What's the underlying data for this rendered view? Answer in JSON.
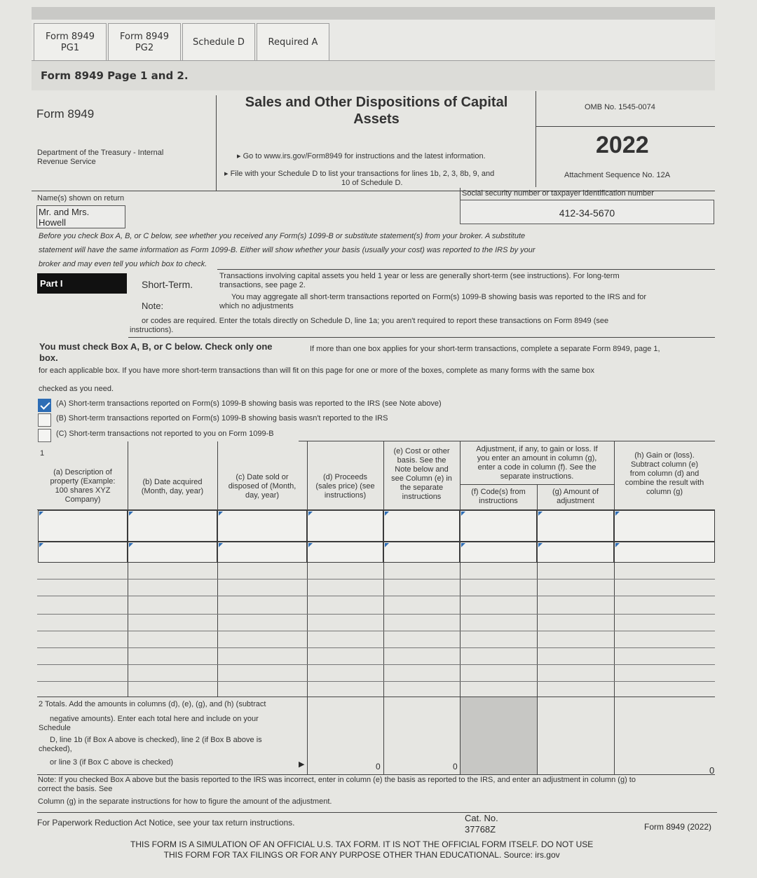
{
  "tabs": [
    {
      "label_1": "Form 8949",
      "label_2": "PG1"
    },
    {
      "label_1": "Form 8949",
      "label_2": "PG2"
    },
    {
      "label_1": "Schedule D",
      "label_2": ""
    },
    {
      "label_1": "Required A",
      "label_2": ""
    }
  ],
  "page_header": "Form 8949 Page 1 and 2.",
  "form": {
    "form_name": "Form 8949",
    "title_1": "Sales and Other Dispositions of Capital",
    "title_2": "Assets",
    "department_1": "Department of the Treasury - Internal",
    "department_2": "Revenue Service",
    "goto_line": "Go to www.irs.gov/Form8949 for instructions and the latest information.",
    "file_line_1": "File with your Schedule D to list your transactions for lines 1b, 2, 3, 8b, 9, and",
    "file_line_2": "10 of Schedule D.",
    "omb": "OMB No. 1545-0074",
    "year": "2022",
    "attachment": "Attachment Sequence No. 12A"
  },
  "taxpayer": {
    "name_label": "Name(s) shown on return",
    "name_value_1": "Mr. and Mrs.",
    "name_value_2": "Howell",
    "ssn_label": "Social security number or taxpayer identification number",
    "ssn_value": "412-34-5670"
  },
  "intro": {
    "line_1": "Before you check Box A, B, or C below, see whether you received any Form(s) 1099-B or substitute statement(s) from your broker. A substitute",
    "line_2": "statement will have the same information as Form 1099-B. Either will show whether your basis (usually your cost) was reported to the IRS by your",
    "line_3": "broker and may even tell you which box to check."
  },
  "part1": {
    "part_label": "Part I",
    "short_term": "Short-Term.",
    "desc_1": "Transactions involving capital assets you held 1 year or less are generally short-term (see instructions). For long-term",
    "desc_2": "transactions, see page 2.",
    "note_label": "Note:",
    "note_1": "You may aggregate all short-term transactions reported on Form(s) 1099-B showing basis was reported to the IRS and for",
    "note_2": "which no adjustments",
    "note_3": "or codes are required. Enter the totals directly on Schedule D, line 1a; you aren't required to report these transactions on Form 8949 (see",
    "note_4": "instructions).",
    "must_check_1": "You must check Box A, B, or C below. Check only one",
    "must_check_2": "box.",
    "more_than_one": "If more than one box applies for your short-term transactions, complete a separate Form 8949, page 1,",
    "each_box": "for each applicable box. If you have more short-term transactions than will fit on this page for one or more of the boxes, complete as many forms with the same box",
    "checked_as": "checked as you need.",
    "options": [
      {
        "label": "(A) Short-term transactions reported on Form(s) 1099-B showing basis was reported to the IRS (see Note above)",
        "checked": true
      },
      {
        "label": "(B) Short-term transactions reported on Form(s) 1099-B showing basis wasn't reported to the IRS",
        "checked": false
      },
      {
        "label": "(C) Short-term transactions not reported to you on Form 1099-B",
        "checked": false
      }
    ]
  },
  "table": {
    "line_num": "1",
    "col_a": [
      "(a) Description of",
      "property (Example:",
      "100 shares XYZ",
      "Company)"
    ],
    "col_b": [
      "(b) Date acquired",
      "(Month, day, year)"
    ],
    "col_c": [
      "(c) Date sold or",
      "disposed of (Month,",
      "day, year)"
    ],
    "col_d": [
      "(d) Proceeds",
      "(sales price) (see",
      "instructions)"
    ],
    "col_e": [
      "(e) Cost or other",
      "basis. See the",
      "Note below and",
      "see Column (e) in",
      "the separate",
      "instructions"
    ],
    "adj_head": [
      "Adjustment, if any, to gain or loss. If",
      "you enter an amount in column (g),",
      "enter a code in column (f). See the",
      "separate instructions."
    ],
    "col_f": [
      "(f) Code(s) from",
      "instructions"
    ],
    "col_g": [
      "(g) Amount of",
      "adjustment"
    ],
    "col_h": [
      "(h) Gain or (loss).",
      "Subtract column (e)",
      "from column (d) and",
      "combine the result with",
      "column (g)"
    ]
  },
  "totals": {
    "line_1": "2  Totals. Add the amounts in columns (d), (e), (g), and (h) (subtract",
    "line_2": "negative amounts). Enter each total here and include on your",
    "line_3": "Schedule",
    "line_4": "D, line 1b (if Box A above is checked), line 2 (if Box B above is",
    "line_5": "checked),",
    "line_6": "or line 3 (if Box C above is checked)",
    "d_total": "0",
    "e_total": "0",
    "h_total": "0"
  },
  "footer_note": {
    "line_1": "Note: If you checked Box A above but the basis reported to the IRS was incorrect, enter in column (e) the basis as reported to the IRS, and enter an adjustment in column (g) to",
    "line_2": "correct the basis. See",
    "line_3": "Column (g) in the separate instructions for how to figure the amount of the adjustment."
  },
  "footer": {
    "paperwork": "For Paperwork Reduction Act Notice, see your tax return instructions.",
    "cat_1": "Cat. No.",
    "cat_2": "37768Z",
    "form_year": "Form 8949 (2022)",
    "disclaimer_1": "THIS FORM IS A SIMULATION OF AN OFFICIAL U.S. TAX FORM. IT IS NOT THE OFFICIAL FORM ITSELF. DO NOT USE",
    "disclaimer_2": "THIS FORM FOR TAX FILINGS OR FOR ANY PURPOSE OTHER THAN EDUCATIONAL. Source: irs.gov"
  }
}
